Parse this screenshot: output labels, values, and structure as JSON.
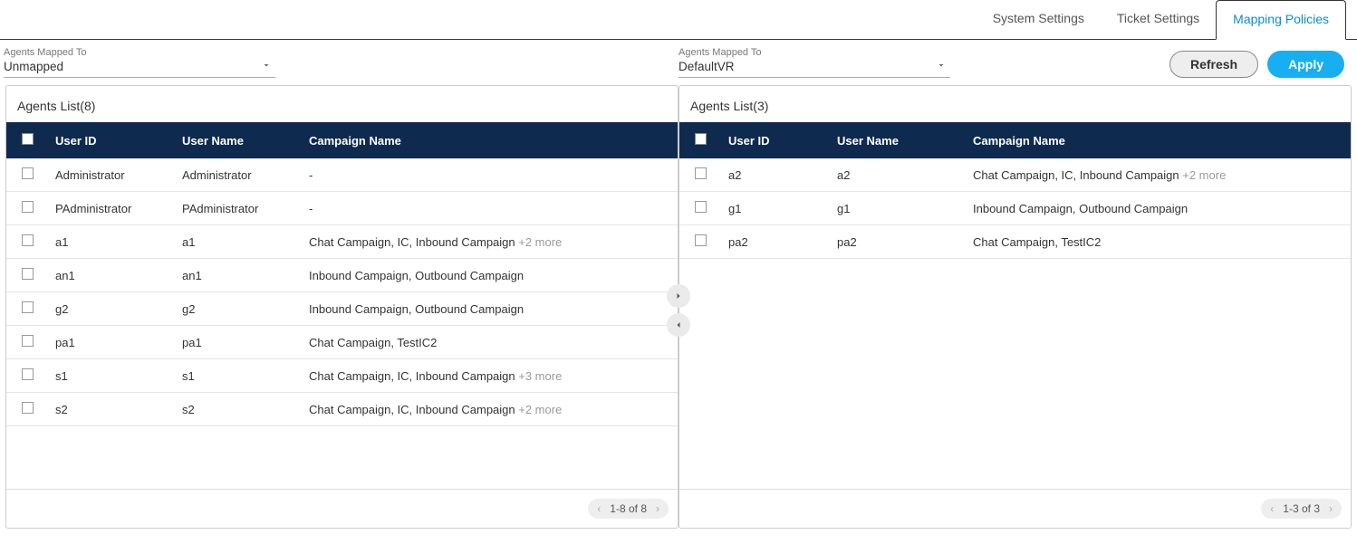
{
  "tabs": {
    "system": "System Settings",
    "ticket": "Ticket Settings",
    "mapping": "Mapping Policies",
    "active": "mapping"
  },
  "dropdownLabel": "Agents Mapped To",
  "left": {
    "dropdownValue": "Unmapped",
    "listTitlePrefix": "Agents List(",
    "listCount": "8",
    "listTitleSuffix": ")",
    "columns": {
      "userId": "User ID",
      "userName": "User Name",
      "campaign": "Campaign Name"
    },
    "rows": [
      {
        "userId": "Administrator",
        "userName": "Administrator",
        "campaign": "-",
        "more": ""
      },
      {
        "userId": "PAdministrator",
        "userName": "PAdministrator",
        "campaign": "-",
        "more": ""
      },
      {
        "userId": "a1",
        "userName": "a1",
        "campaign": "Chat Campaign, IC, Inbound Campaign ",
        "more": "+2 more"
      },
      {
        "userId": "an1",
        "userName": "an1",
        "campaign": "Inbound Campaign, Outbound Campaign",
        "more": ""
      },
      {
        "userId": "g2",
        "userName": "g2",
        "campaign": "Inbound Campaign, Outbound Campaign",
        "more": ""
      },
      {
        "userId": "pa1",
        "userName": "pa1",
        "campaign": "Chat Campaign, TestIC2",
        "more": ""
      },
      {
        "userId": "s1",
        "userName": "s1",
        "campaign": "Chat Campaign, IC, Inbound Campaign ",
        "more": "+3 more"
      },
      {
        "userId": "s2",
        "userName": "s2",
        "campaign": "Chat Campaign, IC, Inbound Campaign ",
        "more": "+2 more"
      }
    ],
    "paginator": "1-8 of 8"
  },
  "right": {
    "dropdownValue": "DefaultVR",
    "listTitlePrefix": "Agents List(",
    "listCount": "3",
    "listTitleSuffix": ")",
    "columns": {
      "userId": "User ID",
      "userName": "User Name",
      "campaign": "Campaign Name"
    },
    "rows": [
      {
        "userId": "a2",
        "userName": "a2",
        "campaign": "Chat Campaign, IC, Inbound Campaign ",
        "more": "+2 more"
      },
      {
        "userId": "g1",
        "userName": "g1",
        "campaign": "Inbound Campaign, Outbound Campaign",
        "more": ""
      },
      {
        "userId": "pa2",
        "userName": "pa2",
        "campaign": "Chat Campaign, TestIC2",
        "more": ""
      }
    ],
    "paginator": "1-3 of 3"
  },
  "buttons": {
    "refresh": "Refresh",
    "apply": "Apply"
  }
}
